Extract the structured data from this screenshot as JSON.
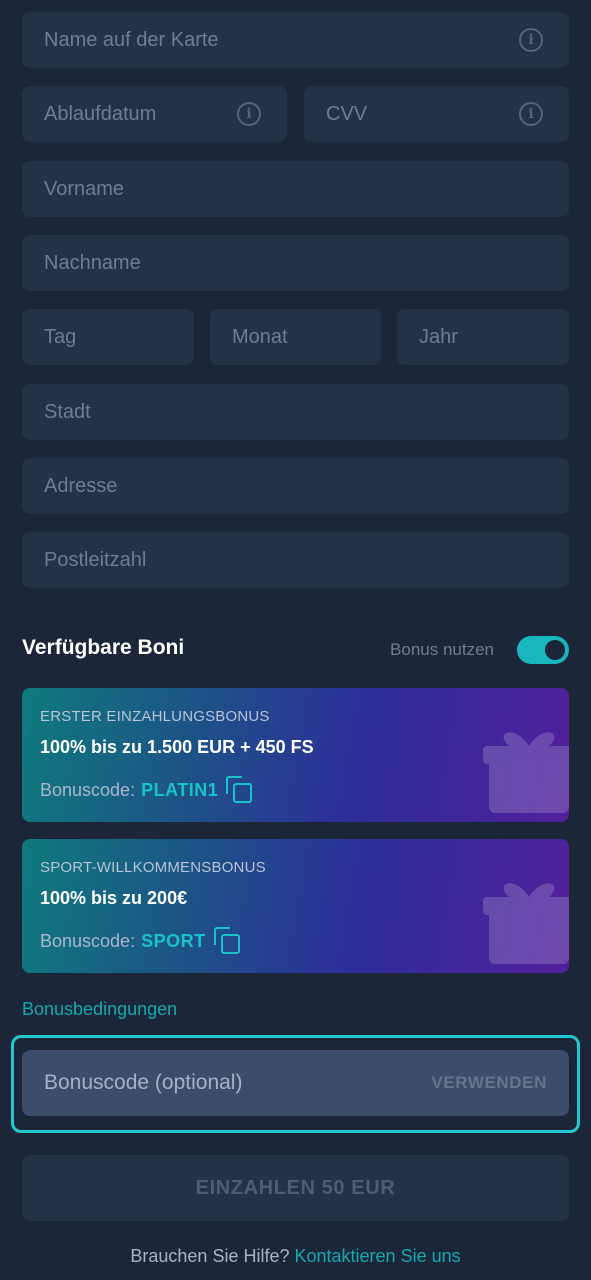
{
  "form": {
    "card_name_placeholder": "Name auf der Karte",
    "expiry_placeholder": "Ablaufdatum",
    "cvv_placeholder": "CVV",
    "first_name_placeholder": "Vorname",
    "last_name_placeholder": "Nachname",
    "day_placeholder": "Tag",
    "month_placeholder": "Monat",
    "year_placeholder": "Jahr",
    "city_placeholder": "Stadt",
    "address_placeholder": "Adresse",
    "postal_placeholder": "Postleitzahl",
    "info_glyph": "i"
  },
  "bonuses": {
    "title": "Verfügbare Boni",
    "toggle_label": "Bonus nutzen",
    "toggle_on": true,
    "items": [
      {
        "eyebrow": "ERSTER EINZAHLUNGSBONUS",
        "headline": "100% bis zu 1.500 EUR + 450 FS",
        "code_label": "Bonuscode:",
        "code": "PLATIN1"
      },
      {
        "eyebrow": "SPORT-WILLKOMMENSBONUS",
        "headline": "100% bis zu 200€",
        "code_label": "Bonuscode:",
        "code": "SPORT"
      }
    ],
    "terms_link": "Bonusbedingungen"
  },
  "promo": {
    "placeholder": "Bonuscode (optional)",
    "apply_label": "VERWENDEN"
  },
  "deposit": {
    "button_label": "EINZAHLEN 50 EUR"
  },
  "help": {
    "prefix": "Brauchen Sie Hilfe?",
    "link": "Kontaktieren Sie uns"
  },
  "colors": {
    "background": "#1b2638",
    "field": "#243247",
    "accent": "#19b6bd",
    "highlight_border": "#22c7cf"
  },
  "icons": [
    "info-icon",
    "copy-icon",
    "gift-icon",
    "toggle-switch"
  ]
}
